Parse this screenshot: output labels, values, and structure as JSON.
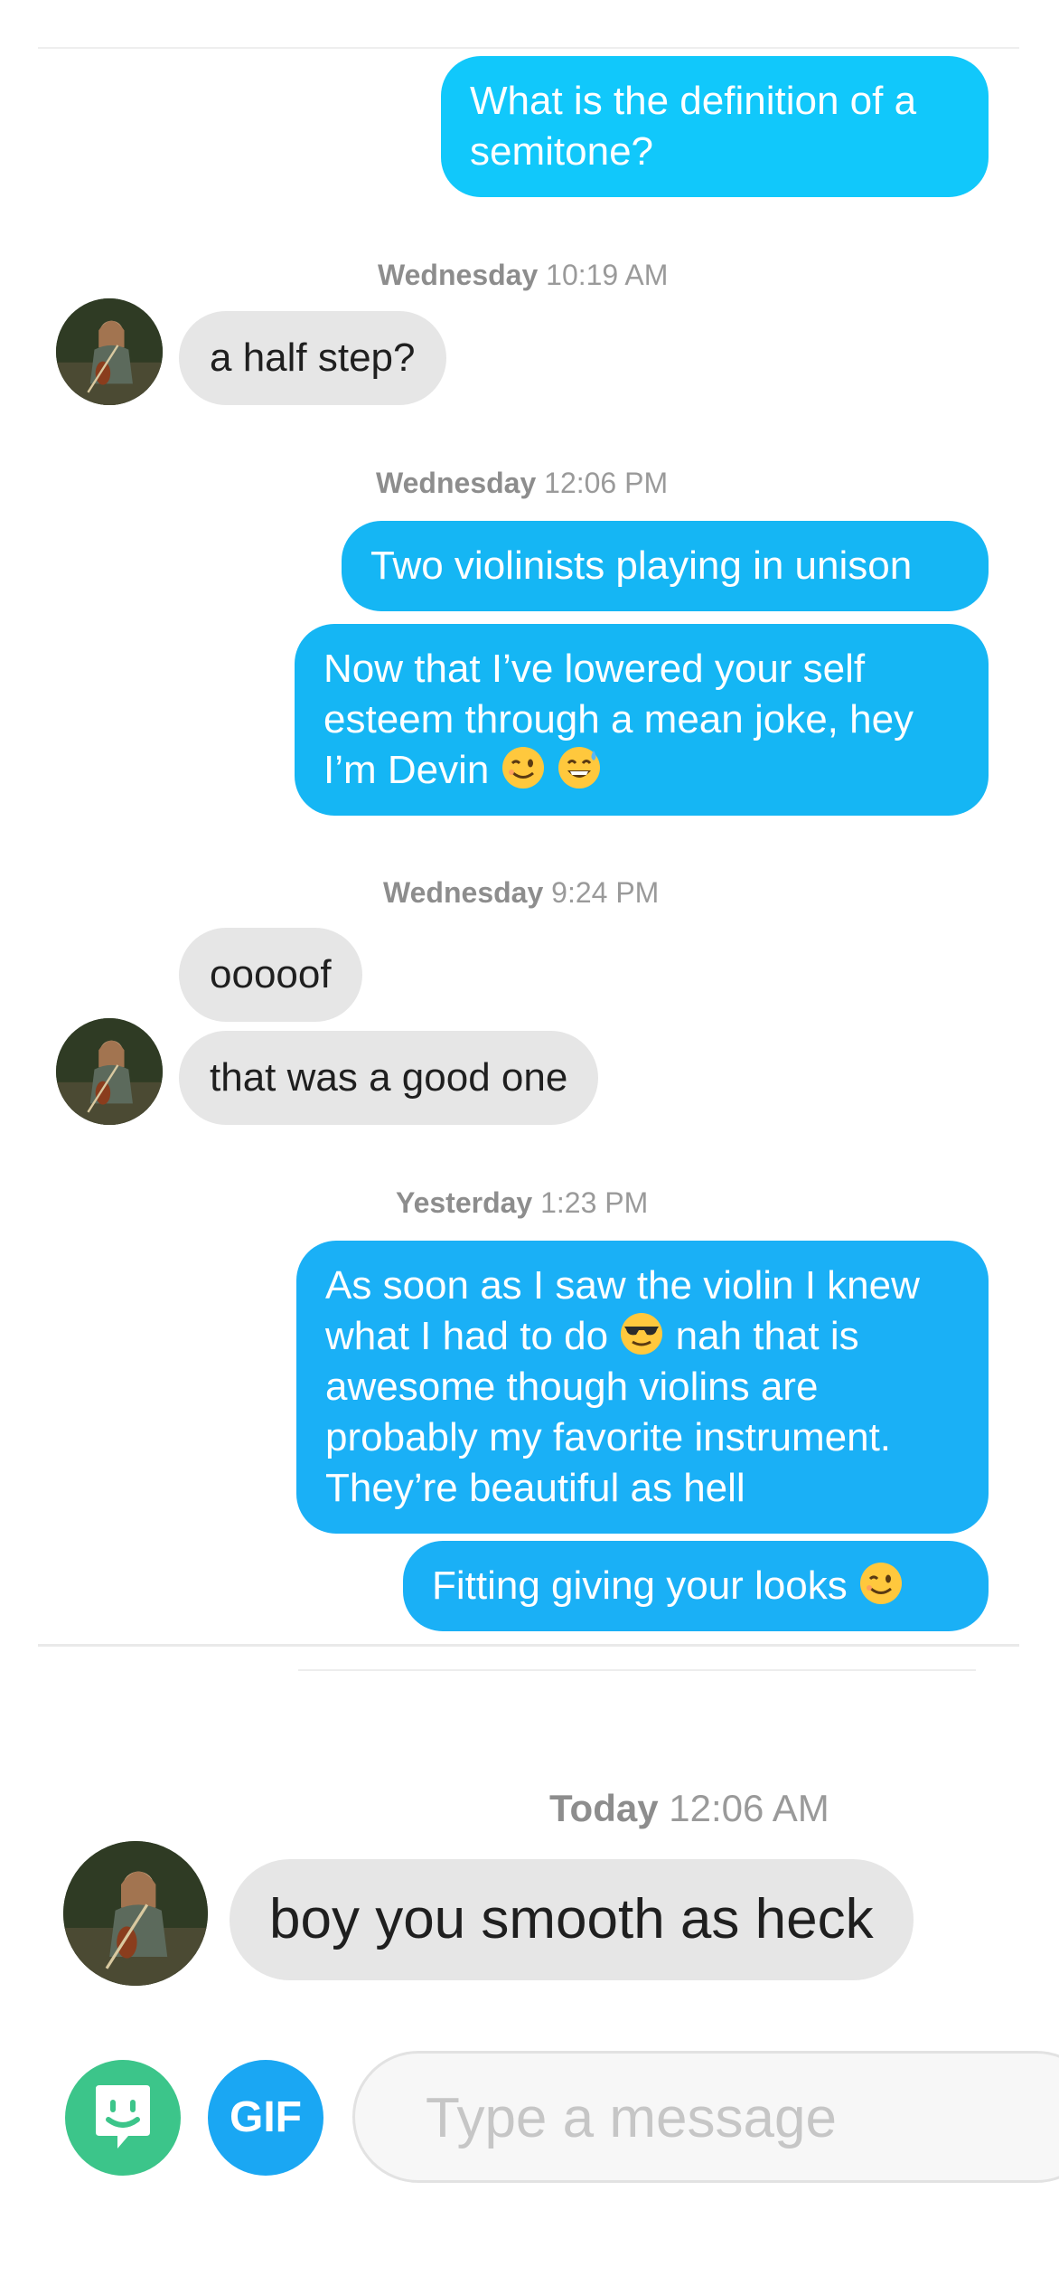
{
  "messages": [
    {
      "kind": "out",
      "text": "What is the definition of a semitone?"
    },
    {
      "kind": "stamp",
      "day": "Wednesday",
      "time": "10:19 AM"
    },
    {
      "kind": "in",
      "text": "a half step?"
    },
    {
      "kind": "stamp",
      "day": "Wednesday",
      "time": "12:06 PM"
    },
    {
      "kind": "out",
      "text": "Two violinists playing in unison"
    },
    {
      "kind": "out",
      "text": "Now that I’ve lowered your self esteem through a mean joke, hey I’m Devin",
      "emojis": [
        "winking-face",
        "grinning-sweat-face"
      ]
    },
    {
      "kind": "stamp",
      "day": "Wednesday",
      "time": "9:24 PM"
    },
    {
      "kind": "in",
      "text": "ooooof"
    },
    {
      "kind": "in",
      "text": "that was a good one"
    },
    {
      "kind": "stamp",
      "day": "Yesterday",
      "time": "1:23 PM"
    },
    {
      "kind": "out",
      "text_before": "As soon as I saw the violin I knew what I had to do",
      "text_after": "nah that is awesome though violins are probably my favorite instrument. They’re beautiful as hell",
      "emojis": [
        "sunglasses-face"
      ]
    },
    {
      "kind": "out",
      "text": "Fitting giving your looks",
      "emojis": [
        "winking-face"
      ]
    },
    {
      "kind": "stamp",
      "day": "Today",
      "time": "12:06 AM"
    },
    {
      "kind": "in",
      "text": "boy you smooth as heck"
    }
  ],
  "composer": {
    "gif_label": "GIF",
    "placeholder": "Type a message",
    "sticker_icon": "sticker-face-icon"
  },
  "colors": {
    "outgoing": "#15b6f4",
    "incoming": "#e6e6e6",
    "sticker_button": "#3cc58a",
    "gif_button": "#1aa7f3"
  }
}
